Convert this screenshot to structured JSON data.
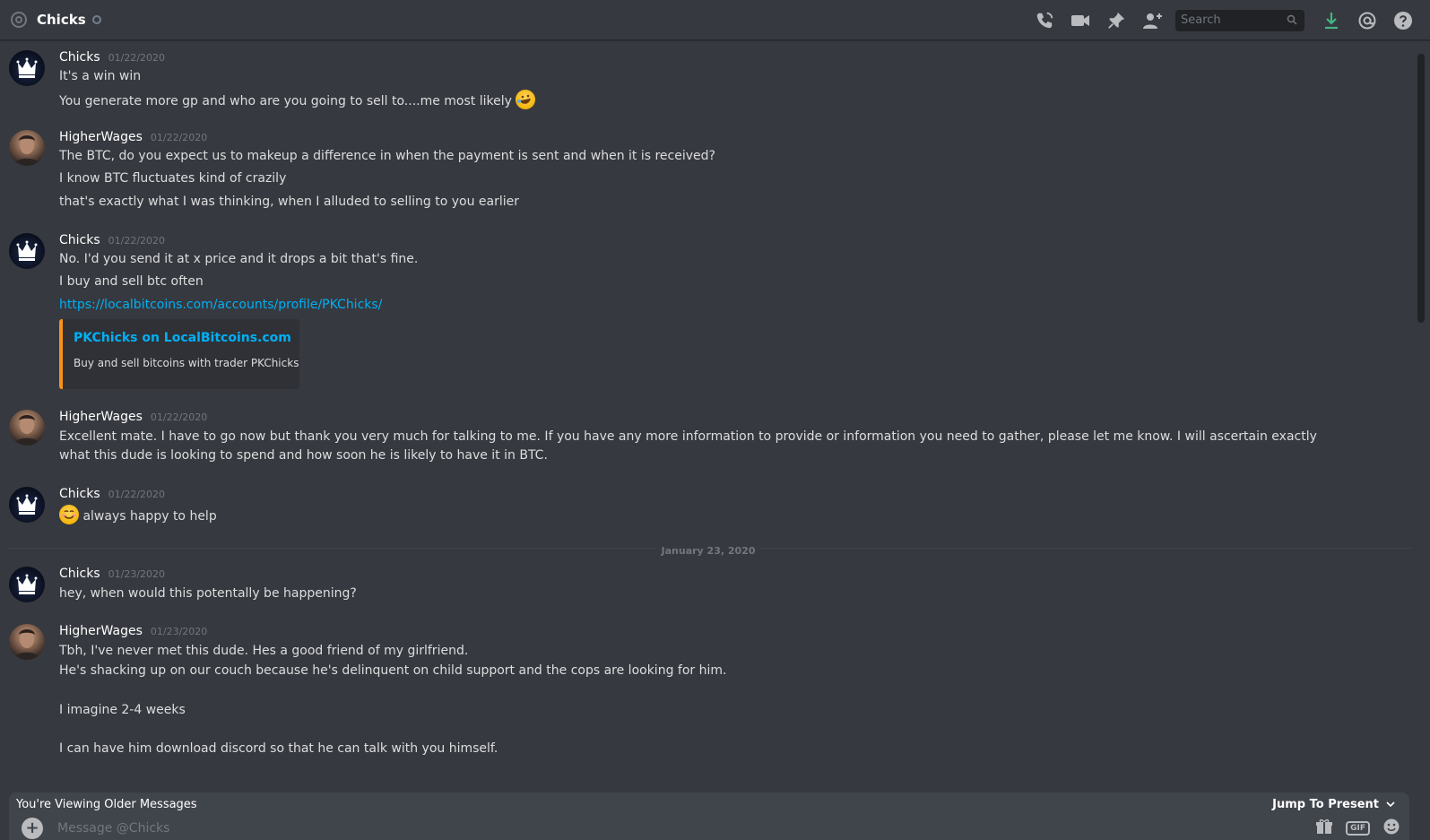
{
  "header": {
    "channel_name": "Chicks",
    "search_placeholder": "Search"
  },
  "messages": [
    {
      "author": "Chicks",
      "timestamp": "01/22/2020",
      "lines": [
        "It's a win win",
        "You generate more gp and who are you going to sell to....me most likely"
      ]
    },
    {
      "author": "HigherWages",
      "timestamp": "01/22/2020",
      "lines": [
        "The BTC, do you expect us to makeup a difference in when the payment is sent and when it is received?",
        "I know BTC fluctuates kind of crazily",
        "that's exactly what I was thinking, when I alluded to selling to you earlier"
      ]
    },
    {
      "author": "Chicks",
      "timestamp": "01/22/2020",
      "lines": [
        "No. I'd you send it at x price and it drops a bit that's fine.",
        "I buy and sell btc often"
      ],
      "link": "https://localbitcoins.com/accounts/profile/PKChicks/",
      "embed": {
        "title": "PKChicks on LocalBitcoins.com",
        "description": "Buy and sell bitcoins with trader PKChicks",
        "accent": "#f7931a"
      }
    },
    {
      "author": "HigherWages",
      "timestamp": "01/22/2020",
      "text": "Excellent mate. I have to go now but thank you very much for talking to me. If you have any more information to provide or information you need to gather, please let me know. I will ascertain exactly what this dude is looking to spend and how soon he is likely to have it in BTC."
    },
    {
      "author": "Chicks",
      "timestamp": "01/22/2020",
      "lines": [
        "always happy to help"
      ]
    },
    {
      "author": "Chicks",
      "timestamp": "01/23/2020",
      "lines": [
        "hey, when would this potentally be happening?"
      ]
    },
    {
      "author": "HigherWages",
      "timestamp": "01/23/2020",
      "lines": [
        "Tbh, I've never met this dude. Hes a good friend of my girlfriend.",
        "He's shacking up on our couch because he's delinquent on child support and the cops are looking for him.",
        "I imagine 2-4 weeks",
        "I can have him download discord so that he can talk with you himself."
      ]
    }
  ],
  "date_divider": "January 23, 2020",
  "older_bar": {
    "text": "You're Viewing Older Messages",
    "jump_label": "Jump To Present"
  },
  "composer": {
    "placeholder": "Message @Chicks",
    "gif_label": "GIF"
  },
  "colors": {
    "background": "#36393f",
    "link": "#00b0f4",
    "embed_accent": "#f7931a",
    "download": "#43b581"
  }
}
